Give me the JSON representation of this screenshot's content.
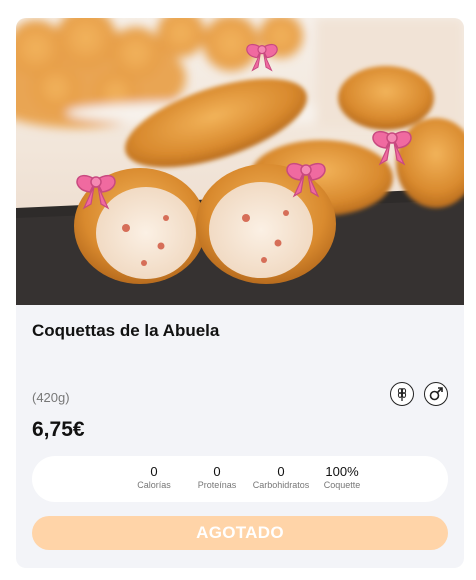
{
  "product": {
    "title": "Coquettas de la Abuela",
    "weight": "(420g)",
    "price": "6,75€",
    "icons": [
      "gluten-icon",
      "male-symbol-icon"
    ]
  },
  "nutrition": [
    {
      "value": "0",
      "label": "Calorías"
    },
    {
      "value": "0",
      "label": "Proteínas"
    },
    {
      "value": "0",
      "label": "Carbohidratos"
    },
    {
      "value": "100%",
      "label": "Coquette"
    }
  ],
  "button": {
    "label": "AGOTADO"
  },
  "colors": {
    "card_bg": "#f3f4f8",
    "button_bg": "#ffd4a8",
    "bow": "#f06aa0"
  }
}
